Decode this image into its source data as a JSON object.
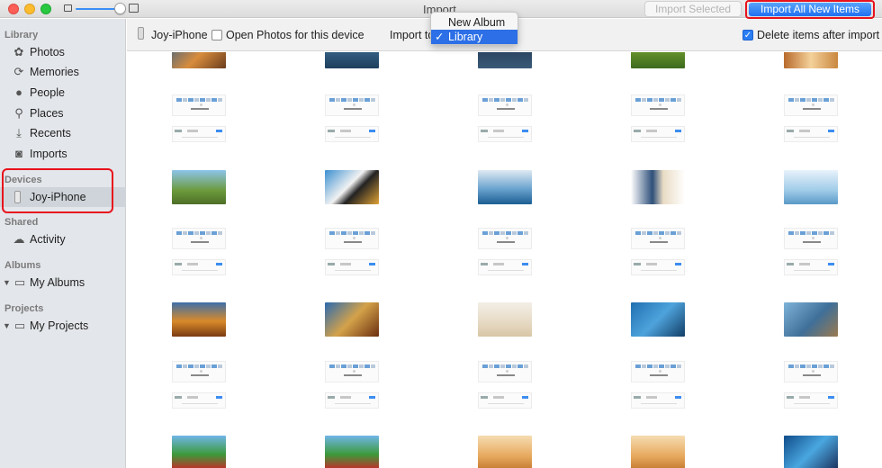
{
  "window": {
    "title": "Import"
  },
  "header": {
    "import_selected_label": "Import Selected",
    "import_all_label": "Import All New Items"
  },
  "sidebar": {
    "library_label": "Library",
    "library_items": [
      {
        "label": "Photos",
        "icon": "photos-icon"
      },
      {
        "label": "Memories",
        "icon": "memories-icon"
      },
      {
        "label": "People",
        "icon": "people-icon"
      },
      {
        "label": "Places",
        "icon": "places-icon"
      },
      {
        "label": "Recents",
        "icon": "recents-icon"
      },
      {
        "label": "Imports",
        "icon": "imports-icon"
      }
    ],
    "devices_label": "Devices",
    "device_item": {
      "label": "Joy-iPhone",
      "icon": "iphone-icon"
    },
    "shared_label": "Shared",
    "shared_item": {
      "label": "Activity",
      "icon": "cloud-icon"
    },
    "albums_label": "Albums",
    "albums_item": {
      "label": "My Albums",
      "icon": "folder-icon"
    },
    "projects_label": "Projects",
    "projects_item": {
      "label": "My Projects",
      "icon": "folder-icon"
    }
  },
  "toolbar": {
    "device_name": "Joy-iPhone",
    "open_photos_label": "Open Photos for this device",
    "open_photos_checked": false,
    "import_to_label": "Import to",
    "delete_after_label": "Delete items after import",
    "delete_after_checked": true
  },
  "import_menu": {
    "options": [
      "New Album",
      "Library"
    ],
    "selected": "Library",
    "check_glyph": "✓"
  },
  "colors": {
    "accent_blue": "#2c6fe6",
    "highlight_red": "#e8121c",
    "sidebar_bg": "#e3e6ea"
  }
}
